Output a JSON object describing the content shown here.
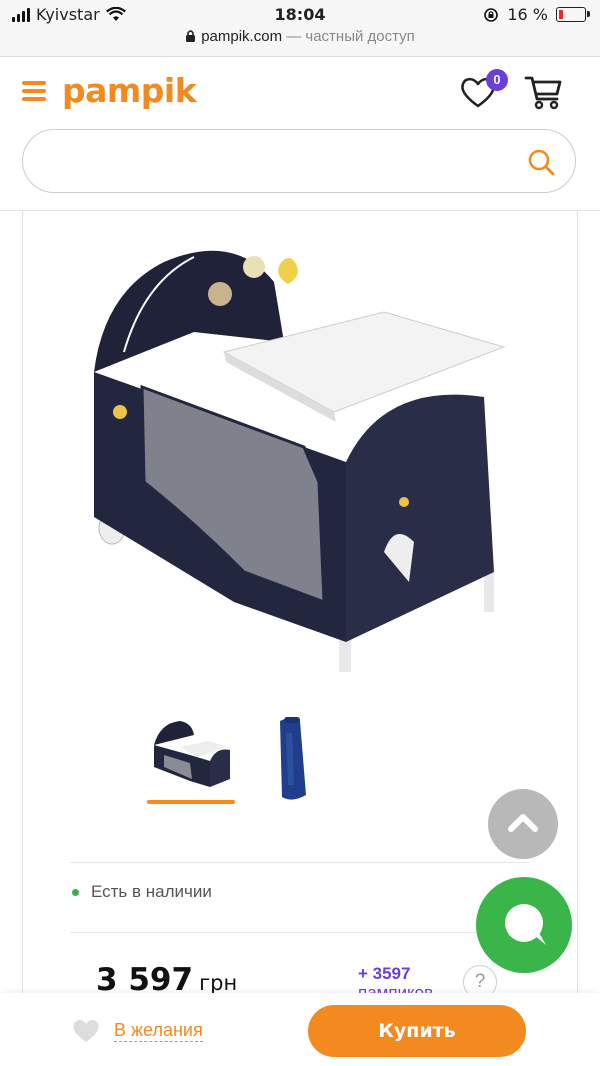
{
  "status_bar": {
    "carrier": "Kyivstar",
    "time": "18:04",
    "battery_percent": "16 %",
    "battery_level": 0.16
  },
  "url_bar": {
    "domain": "pampik.com",
    "suffix": " — частный доступ"
  },
  "header": {
    "logo_text": "pampik",
    "wishlist_count": "0"
  },
  "search": {
    "value": "",
    "placeholder": ""
  },
  "product": {
    "gallery": {
      "images": [
        "crib-main",
        "crib-folded-bag"
      ],
      "selected_index": 0
    },
    "stock_status": "Есть в наличии",
    "price_value": "3 597",
    "price_currency": "грн",
    "bonus_amount": "+ 3597",
    "bonus_label": "пампиков",
    "help_label": "?"
  },
  "bottom_bar": {
    "wishlist_label": "В желания",
    "buy_label": "Купить"
  },
  "colors": {
    "accent": "#f28a1f",
    "badge": "#6a3fd8",
    "chat": "#3ab54a",
    "in_stock": "#35b34a"
  }
}
